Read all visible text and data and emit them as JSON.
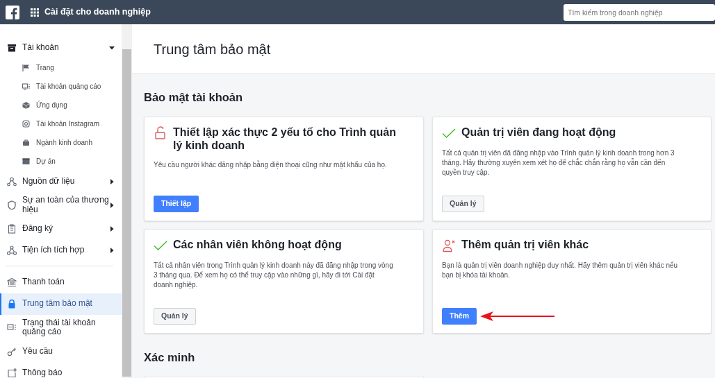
{
  "header": {
    "title": "Cài đặt cho doanh nghiệp",
    "search": {
      "placeholder": "Tìm kiếm trong doanh nghiệp"
    }
  },
  "sidebar": {
    "items": [
      {
        "label": "Tài khoản",
        "kind": "group",
        "expanded": true,
        "selected": false,
        "children": [
          {
            "label": "Trang",
            "selected": false
          },
          {
            "label": "Tài khoản quảng cáo",
            "selected": false
          },
          {
            "label": "Ứng dụng",
            "selected": false
          },
          {
            "label": "Tài khoản Instagram",
            "selected": false
          },
          {
            "label": "Ngành kinh doanh",
            "selected": false
          },
          {
            "label": "Dự án",
            "selected": false
          }
        ]
      },
      {
        "label": "Nguồn dữ liệu",
        "kind": "group",
        "expanded": false,
        "selected": false
      },
      {
        "label": "Sự an toàn của thương hiệu",
        "kind": "group",
        "expanded": false,
        "selected": false
      },
      {
        "label": "Đăng ký",
        "kind": "group",
        "expanded": false,
        "selected": false
      },
      {
        "label": "Tiện ích tích hợp",
        "kind": "group",
        "expanded": false,
        "selected": false
      },
      {
        "kind": "divider"
      },
      {
        "label": "Thanh toán",
        "kind": "link",
        "selected": false
      },
      {
        "label": "Trung tâm bảo mật",
        "kind": "link",
        "selected": true
      },
      {
        "label": "Trạng thái tài khoản quảng cáo",
        "kind": "link",
        "selected": false
      },
      {
        "label": "Yêu cầu",
        "kind": "link",
        "selected": false
      },
      {
        "label": "Thông báo",
        "kind": "link",
        "selected": false
      }
    ]
  },
  "page_title": "Trung tâm bảo mật",
  "sections": [
    {
      "title": "Bảo mật tài khoản",
      "cards": [
        {
          "title": "Thiết lập xác thực 2 yếu tố cho Trình quản lý kinh doanh",
          "kind": "warning",
          "text": "Yêu cầu người khác đăng nhập bằng điện thoại cũng như mật khẩu của họ.",
          "button": {
            "label": "Thiết lập",
            "primary": true
          }
        },
        {
          "title": "Quản trị viên đang hoạt động",
          "kind": "ok",
          "text": "Tất cả quản trị viên đã đăng nhập vào Trình quản lý kinh doanh trong hơn 3 tháng. Hãy thường xuyên xem xét họ để chắc chắn rằng họ vẫn cần đến quyền truy cập.",
          "button": {
            "label": "Quản lý",
            "primary": false
          }
        },
        {
          "title": "Các nhân viên không hoạt động",
          "kind": "ok",
          "text": "Tất cả nhân viên trong Trình quản lý kinh doanh này đã đăng nhập trong vòng 3 tháng qua. Để xem họ có thể truy cập vào những gì, hãy đi tới Cài đặt doanh nghiệp.",
          "button": {
            "label": "Quản lý",
            "primary": false
          }
        },
        {
          "title": "Thêm quản trị viên khác",
          "kind": "warning",
          "text": "Bạn là quản trị viên doanh nghiệp duy nhất. Hãy thêm quản trị viên khác nếu bạn bị khóa tài khoản.",
          "button": {
            "label": "Thêm",
            "primary": true
          },
          "annotated": true
        }
      ]
    },
    {
      "title": "Xác minh"
    }
  ]
}
